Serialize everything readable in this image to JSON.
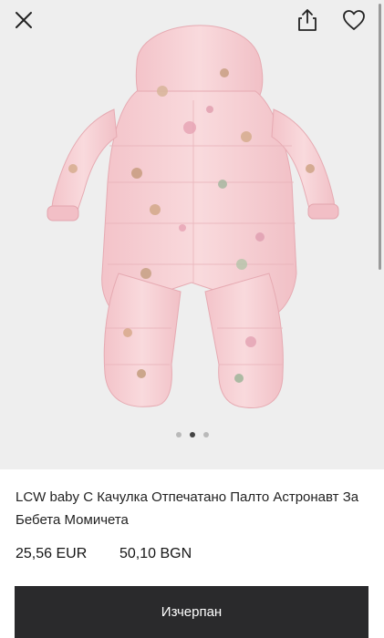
{
  "product": {
    "title": "LCW baby С Качулка Отпечатано Палто Астронавт За Бебета Момичета",
    "price_eur": "25,56 EUR",
    "price_bgn": "50,10 BGN"
  },
  "gallery": {
    "image_count": 3,
    "active_image": 2,
    "image_alt": "Pink hooded baby snowsuit with woodland animal print"
  },
  "header": {
    "icons": [
      "close-icon",
      "share-icon",
      "heart-icon"
    ]
  },
  "actions": {
    "sold_out_label": "Изчерпан"
  },
  "colors": {
    "button_bg": "#2a2a2c",
    "gallery_bg": "#eeeeee",
    "garment_pink": "#f6cfd3"
  }
}
